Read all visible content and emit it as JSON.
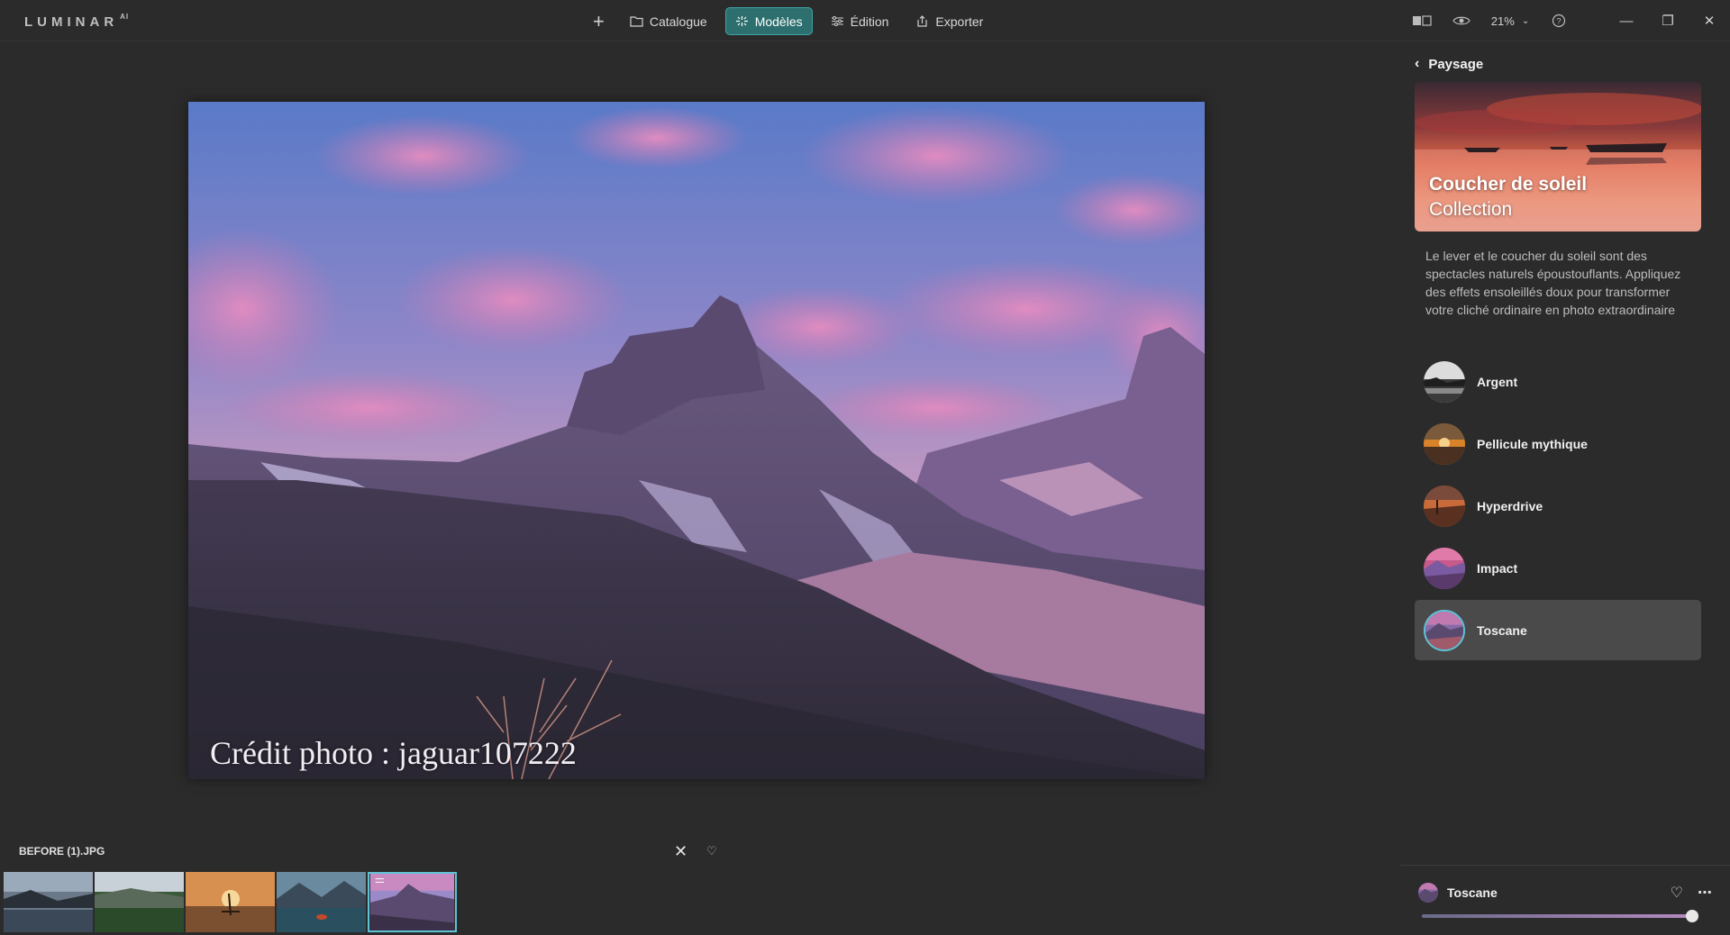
{
  "app": {
    "logo": "LUMINAR",
    "logo_sup": "AI"
  },
  "nav": {
    "add_label": "+",
    "items": [
      {
        "label": "Catalogue",
        "icon": "folder-icon"
      },
      {
        "label": "Modèles",
        "icon": "sparkle-icon",
        "active": true
      },
      {
        "label": "Édition",
        "icon": "sliders-icon"
      },
      {
        "label": "Exporter",
        "icon": "export-icon"
      }
    ]
  },
  "toolbar": {
    "zoom": "21%"
  },
  "photo": {
    "credit": "Crédit photo : jaguar107222"
  },
  "panel": {
    "back_label": "Paysage",
    "hero_title": "Coucher de soleil",
    "hero_subtitle": "Collection",
    "description": "Le lever et le coucher du soleil sont des spectacles naturels époustouflants. Appliquez des effets ensoleillés doux pour transformer votre cliché ordinaire en photo extraordinaire",
    "presets": [
      {
        "label": "Argent"
      },
      {
        "label": "Pellicule mythique"
      },
      {
        "label": "Hyperdrive"
      },
      {
        "label": "Impact"
      },
      {
        "label": "Toscane",
        "selected": true
      }
    ],
    "current_preset": "Toscane",
    "amount": 1.0
  },
  "filmstrip": {
    "filename": "BEFORE (1).JPG",
    "active_index": 4
  },
  "colors": {
    "accent": "#2d6f6f",
    "selection": "#5fc3d6"
  }
}
